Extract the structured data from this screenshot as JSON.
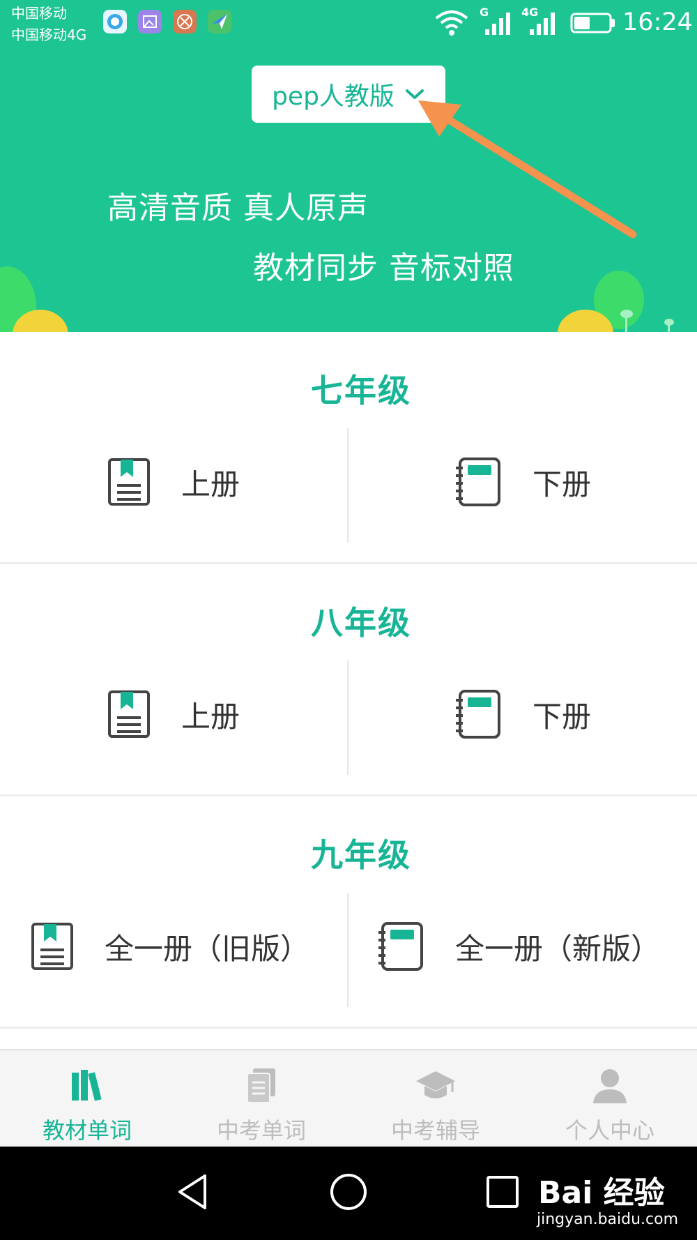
{
  "status_bar": {
    "carrier_primary": "中国移动",
    "carrier_secondary": "中国移动4G",
    "signal_1_label": "G",
    "signal_2_label": "4G",
    "time": "16:24"
  },
  "header": {
    "edition_selector": "pep人教版",
    "slogan_line_1": "高清音质 真人原声",
    "slogan_line_2": "教材同步 音标对照"
  },
  "grades": [
    {
      "title": "七年级",
      "left_book": "上册",
      "right_book": "下册"
    },
    {
      "title": "八年级",
      "left_book": "上册",
      "right_book": "下册"
    },
    {
      "title": "九年级",
      "left_book": "全一册（旧版）",
      "right_book": "全一册（新版）"
    }
  ],
  "tabs": [
    {
      "label": "教材单词",
      "icon": "books-icon",
      "active": true
    },
    {
      "label": "中考单词",
      "icon": "document-icon",
      "active": false
    },
    {
      "label": "中考辅导",
      "icon": "graduation-cap-icon",
      "active": false
    },
    {
      "label": "个人中心",
      "icon": "person-icon",
      "active": false
    }
  ],
  "watermark": {
    "brand": "Bai 经验",
    "url": "jingyan.baidu.com"
  },
  "colors": {
    "accent": "#17b596",
    "header_bg": "#1cc592",
    "annotation_arrow": "#f5924e",
    "inactive_tab": "#bdbdbd"
  }
}
